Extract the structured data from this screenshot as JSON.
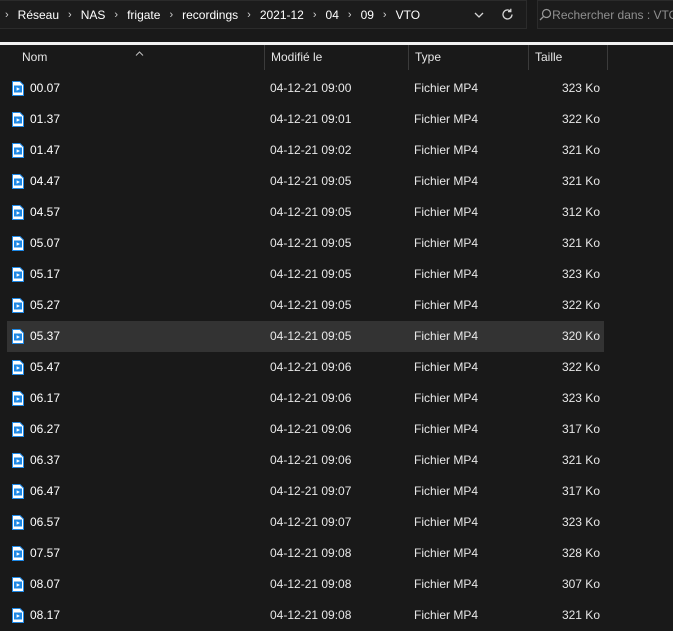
{
  "address": {
    "crumbs": [
      "Réseau",
      "NAS",
      "frigate",
      "recordings",
      "2021-12",
      "04",
      "09",
      "VTO"
    ]
  },
  "search": {
    "placeholder": "Rechercher dans : VTO"
  },
  "columns": {
    "name": "Nom",
    "modified": "Modifié le",
    "type": "Type",
    "size": "Taille"
  },
  "files": [
    {
      "name": "00.07",
      "modified": "04-12-21 09:00",
      "type": "Fichier MP4",
      "size": "323 Ko"
    },
    {
      "name": "01.37",
      "modified": "04-12-21 09:01",
      "type": "Fichier MP4",
      "size": "322 Ko"
    },
    {
      "name": "01.47",
      "modified": "04-12-21 09:02",
      "type": "Fichier MP4",
      "size": "321 Ko"
    },
    {
      "name": "04.47",
      "modified": "04-12-21 09:05",
      "type": "Fichier MP4",
      "size": "321 Ko"
    },
    {
      "name": "04.57",
      "modified": "04-12-21 09:05",
      "type": "Fichier MP4",
      "size": "312 Ko"
    },
    {
      "name": "05.07",
      "modified": "04-12-21 09:05",
      "type": "Fichier MP4",
      "size": "321 Ko"
    },
    {
      "name": "05.17",
      "modified": "04-12-21 09:05",
      "type": "Fichier MP4",
      "size": "323 Ko"
    },
    {
      "name": "05.27",
      "modified": "04-12-21 09:05",
      "type": "Fichier MP4",
      "size": "322 Ko"
    },
    {
      "name": "05.37",
      "modified": "04-12-21 09:05",
      "type": "Fichier MP4",
      "size": "320 Ko",
      "selected": true
    },
    {
      "name": "05.47",
      "modified": "04-12-21 09:06",
      "type": "Fichier MP4",
      "size": "322 Ko"
    },
    {
      "name": "06.17",
      "modified": "04-12-21 09:06",
      "type": "Fichier MP4",
      "size": "323 Ko"
    },
    {
      "name": "06.27",
      "modified": "04-12-21 09:06",
      "type": "Fichier MP4",
      "size": "317 Ko"
    },
    {
      "name": "06.37",
      "modified": "04-12-21 09:06",
      "type": "Fichier MP4",
      "size": "321 Ko"
    },
    {
      "name": "06.47",
      "modified": "04-12-21 09:07",
      "type": "Fichier MP4",
      "size": "317 Ko"
    },
    {
      "name": "06.57",
      "modified": "04-12-21 09:07",
      "type": "Fichier MP4",
      "size": "323 Ko"
    },
    {
      "name": "07.57",
      "modified": "04-12-21 09:08",
      "type": "Fichier MP4",
      "size": "328 Ko"
    },
    {
      "name": "08.07",
      "modified": "04-12-21 09:08",
      "type": "Fichier MP4",
      "size": "307 Ko"
    },
    {
      "name": "08.17",
      "modified": "04-12-21 09:08",
      "type": "Fichier MP4",
      "size": "321 Ko"
    }
  ],
  "colors": {
    "background": "#191919",
    "selected_row": "#333333",
    "icon_blue": "#1e88e5"
  }
}
